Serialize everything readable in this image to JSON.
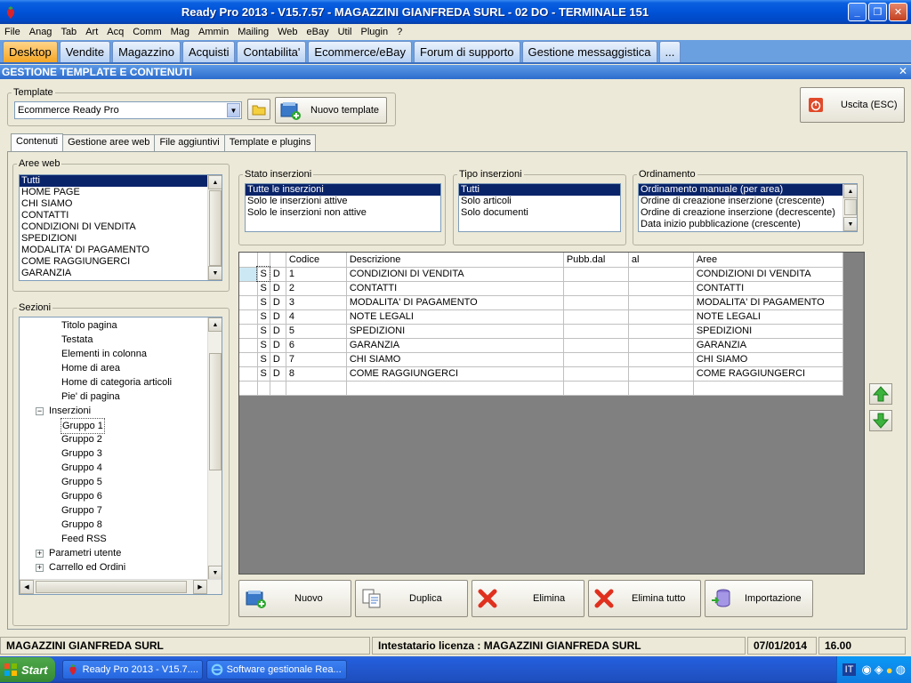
{
  "window": {
    "title": "Ready Pro 2013 - V15.7.57 - MAGAZZINI GIANFREDA SURL - 02 DO - TERMINALE 151"
  },
  "menu": [
    "File",
    "Anag",
    "Tab",
    "Art",
    "Acq",
    "Comm",
    "Mag",
    "Ammin",
    "Mailing",
    "Web",
    "eBay",
    "Util",
    "Plugin",
    "?"
  ],
  "module_tabs": [
    {
      "label": "Desktop",
      "active": true
    },
    {
      "label": "Vendite"
    },
    {
      "label": "Magazzino"
    },
    {
      "label": "Acquisti"
    },
    {
      "label": "Contabilita'"
    },
    {
      "label": "Ecommerce/eBay"
    },
    {
      "label": "Forum di supporto"
    },
    {
      "label": "Gestione messaggistica"
    },
    {
      "label": "..."
    }
  ],
  "form": {
    "title": "GESTIONE TEMPLATE E CONTENUTI",
    "template_label": "Template",
    "template_value": "Ecommerce Ready Pro",
    "new_template": "Nuovo template",
    "exit": "Uscita (ESC)",
    "subtabs": [
      "Contenuti",
      "Gestione aree web",
      "File aggiuntivi",
      "Template e plugins"
    ],
    "aree_web": {
      "label": "Aree web",
      "items": [
        "Tutti",
        "HOME PAGE",
        "CHI SIAMO",
        "CONTATTI",
        "CONDIZIONI DI VENDITA",
        "SPEDIZIONI",
        "MODALITA' DI PAGAMENTO",
        "COME RAGGIUNGERCI",
        "GARANZIA"
      ]
    },
    "sezioni": {
      "label": "Sezioni",
      "items": [
        {
          "label": "Titolo pagina",
          "level": 2
        },
        {
          "label": "Testata",
          "level": 2
        },
        {
          "label": "Elementi in colonna",
          "level": 2
        },
        {
          "label": "Home di area",
          "level": 2
        },
        {
          "label": "Home di categoria articoli",
          "level": 2
        },
        {
          "label": "Pie' di pagina",
          "level": 2
        },
        {
          "label": "Inserzioni",
          "level": 1,
          "expander": "−"
        },
        {
          "label": "Gruppo 1",
          "level": 2,
          "selected": true
        },
        {
          "label": "Gruppo 2",
          "level": 2
        },
        {
          "label": "Gruppo 3",
          "level": 2
        },
        {
          "label": "Gruppo 4",
          "level": 2
        },
        {
          "label": "Gruppo 5",
          "level": 2
        },
        {
          "label": "Gruppo 6",
          "level": 2
        },
        {
          "label": "Gruppo 7",
          "level": 2
        },
        {
          "label": "Gruppo 8",
          "level": 2
        },
        {
          "label": "Feed RSS",
          "level": 2
        },
        {
          "label": "Parametri utente",
          "level": 1,
          "expander": "+"
        },
        {
          "label": "Carrello ed Ordini",
          "level": 1,
          "expander": "+"
        }
      ]
    },
    "stato": {
      "label": "Stato inserzioni",
      "items": [
        "Tutte le inserzioni",
        "Solo le inserzioni attive",
        "Solo le inserzioni non attive"
      ]
    },
    "tipo": {
      "label": "Tipo inserzioni",
      "items": [
        "Tutti",
        "Solo articoli",
        "Solo documenti"
      ]
    },
    "ordinamento": {
      "label": "Ordinamento",
      "items": [
        "Ordinamento manuale (per area)",
        "Ordine di creazione inserzione (crescente)",
        "Ordine di creazione inserzione (decrescente)",
        "Data inizio pubblicazione (crescente)"
      ]
    },
    "grid": {
      "headers": [
        "",
        "",
        "",
        "Codice",
        "Descrizione",
        "Pubb.dal",
        "al",
        "Aree"
      ],
      "rows": [
        [
          "S",
          "D",
          "1",
          "CONDIZIONI DI VENDITA",
          "",
          "",
          "CONDIZIONI DI VENDITA"
        ],
        [
          "S",
          "D",
          "2",
          "CONTATTI",
          "",
          "",
          "CONTATTI"
        ],
        [
          "S",
          "D",
          "3",
          "MODALITA' DI PAGAMENTO",
          "",
          "",
          "MODALITA' DI PAGAMENTO"
        ],
        [
          "S",
          "D",
          "4",
          "NOTE LEGALI",
          "",
          "",
          "NOTE LEGALI"
        ],
        [
          "S",
          "D",
          "5",
          "SPEDIZIONI",
          "",
          "",
          "SPEDIZIONI"
        ],
        [
          "S",
          "D",
          "6",
          "GARANZIA",
          "",
          "",
          "GARANZIA"
        ],
        [
          "S",
          "D",
          "7",
          "CHI SIAMO",
          "",
          "",
          "CHI SIAMO"
        ],
        [
          "S",
          "D",
          "8",
          "COME RAGGIUNGERCI",
          "",
          "",
          "COME RAGGIUNGERCI"
        ]
      ]
    },
    "buttons": {
      "nuovo": "Nuovo",
      "duplica": "Duplica",
      "elimina": "Elimina",
      "elimina_tutto": "Elimina tutto",
      "importazione": "Importazione"
    }
  },
  "status": {
    "company": "MAGAZZINI GIANFREDA SURL",
    "license": "Intestatario licenza : MAGAZZINI GIANFREDA SURL",
    "date": "07/01/2014",
    "time": "16.00"
  },
  "taskbar": {
    "start": "Start",
    "items": [
      "Ready Pro 2013 - V15.7....",
      "Software gestionale Rea..."
    ],
    "lang": "IT"
  },
  "colors": {
    "selection": "#0a246a",
    "active_tab": "#f5a623",
    "title_blue": "#0052d6"
  }
}
